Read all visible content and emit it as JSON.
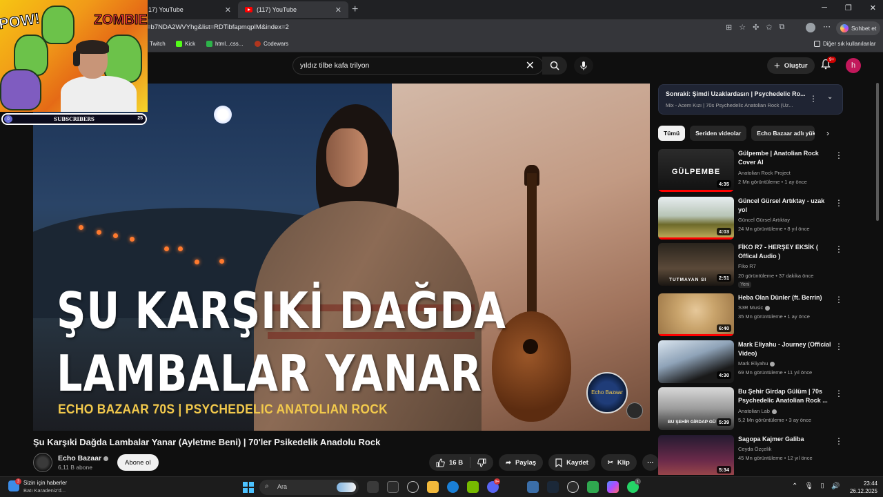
{
  "browser": {
    "tabs": [
      {
        "label": "17) YouTube"
      },
      {
        "label": "(117) YouTube"
      }
    ],
    "url": "=b7NDA2WVYhg&list=RDTibfapmqpIM&index=2",
    "copilot_label": "Sohbet et",
    "bookmarks": [
      {
        "label": "Twitch",
        "icon": "twitch-icon"
      },
      {
        "label": "Kick",
        "icon": "kick-icon"
      },
      {
        "label": "html...css...",
        "icon": "w-icon"
      },
      {
        "label": "Codewars",
        "icon": "codewars-icon"
      }
    ],
    "other_bookmarks": "Diğer sık kullanılanlar"
  },
  "youtube": {
    "search_query": "yıldız tilbe kafa trilyon",
    "create_label": "Oluştur",
    "notif_count": "9+",
    "avatar_letter": "h"
  },
  "overlay": {
    "pow": "POW!",
    "zombie": "ZOMBIE!",
    "subs_label": "SUBSCRIBERS",
    "subs_left": "0",
    "subs_right": "25"
  },
  "video": {
    "thumb_line1": "ŞU KARŞIKİ DAĞDA",
    "thumb_line2": "LAMBALAR YANAR",
    "thumb_subline": "ECHO BAZAAR 70S | PSYCHEDELIC ANATOLIAN ROCK",
    "logo_text": "Echo Bazaar",
    "title": "Şu Karşıki Dağda Lambalar Yanar (Ayletme Beni) | 70'ler Psikedelik Anadolu Rock",
    "channel": "Echo Bazaar",
    "subscribers": "6,11 B abone",
    "subscribe_label": "Abone ol",
    "likes": "16 B",
    "share_label": "Paylaş",
    "save_label": "Kaydet",
    "clip_label": "Klip"
  },
  "next_up": {
    "title": "Sonraki: Şimdi Uzaklardasın | Psychedelic Ro...",
    "subtitle": "Mix - Acem Kızı | 70s Psychedelic Anatolian Rock (Uz..."
  },
  "chips": [
    "Tümü",
    "Seriden videolar",
    "Echo Bazaar adlı yükl"
  ],
  "recommendations": [
    {
      "title": "Gülpembe | Anatolian Rock Cover AI",
      "channel": "Anatolian Rock Project",
      "meta": "2 Mn görüntüleme • 1 ay önce",
      "duration": "4:35",
      "thumb_text": "GÜLPEMBE",
      "verified": false,
      "new": ""
    },
    {
      "title": "Güncel Gürsel Artıktay - uzak yol",
      "channel": "Güncel Gürsel Artıktay",
      "meta": "24 Mn görüntüleme • 8 yıl önce",
      "duration": "4:03",
      "thumb_text": "",
      "verified": false,
      "new": ""
    },
    {
      "title": "FİKO R7 - HERŞEY EKSİK ( Offical Audio )",
      "channel": "Fiko    R7",
      "meta": "20 görüntüleme • 37 dakika önce",
      "duration": "2:51",
      "thumb_text": "TUTMAYAN SI",
      "verified": false,
      "new": "Yeni"
    },
    {
      "title": "Heba Olan Dünler (ft. Berrin)",
      "channel": "S3R Music",
      "meta": "35 Mn görüntüleme • 1 ay önce",
      "duration": "6:40",
      "thumb_text": "",
      "verified": true,
      "new": ""
    },
    {
      "title": "Mark Eliyahu - Journey (Official Video)",
      "channel": "Mark Eliyahu",
      "meta": "69 Mn görüntüleme • 11 yıl önce",
      "duration": "4:30",
      "thumb_text": "",
      "verified": true,
      "new": ""
    },
    {
      "title": "Bu Şehir Girdap Gülüm | 70s Psychedelic Anatolian Rock ...",
      "channel": "Anatolian Lab",
      "meta": "5,2 Mn görüntüleme • 3 ay önce",
      "duration": "5:39",
      "thumb_text": "BU ŞEHİR GİRDAP GÜ",
      "verified": true,
      "new": ""
    },
    {
      "title": "Sagopa Kajmer Galiba",
      "channel": "Ceyda Özçelik",
      "meta": "45 Mn görüntüleme • 12 yıl önce",
      "duration": "5:34",
      "thumb_text": "",
      "verified": false,
      "new": ""
    }
  ],
  "taskbar": {
    "news_title": "Sizin için haberler",
    "news_sub": "Batı Karadeniz'd...",
    "news_badge": "3",
    "search_label": "Ara",
    "discord_badge": "9+",
    "whatsapp_badge": "1",
    "time": "23:44",
    "date": "26.12.2025"
  }
}
